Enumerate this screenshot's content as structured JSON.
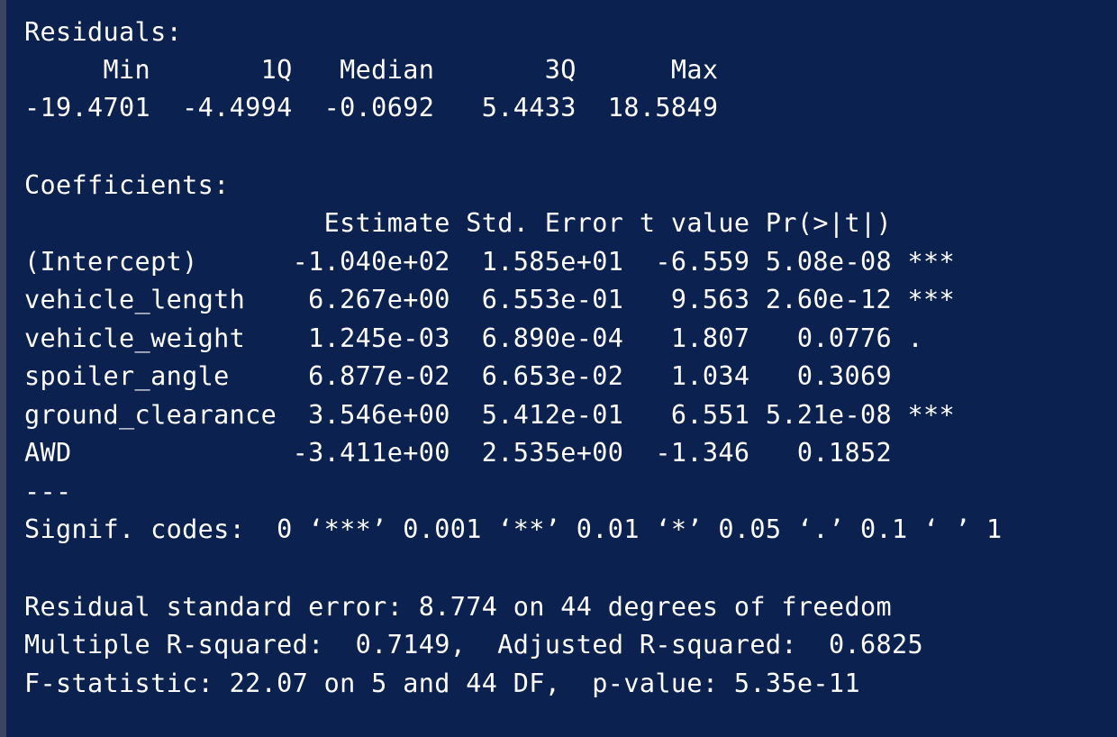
{
  "console": {
    "lines": [
      "Residuals:",
      "     Min       1Q   Median       3Q      Max",
      "-19.4701  -4.4994  -0.0692   5.4433  18.5849",
      "",
      "Coefficients:",
      "                   Estimate Std. Error t value Pr(>|t|)",
      "(Intercept)      -1.040e+02  1.585e+01  -6.559 5.08e-08 ***",
      "vehicle_length    6.267e+00  6.553e-01   9.563 2.60e-12 ***",
      "vehicle_weight    1.245e-03  6.890e-04   1.807   0.0776 .",
      "spoiler_angle     6.877e-02  6.653e-02   1.034   0.3069",
      "ground_clearance  3.546e+00  5.412e-01   6.551 5.21e-08 ***",
      "AWD              -3.411e+00  2.535e+00  -1.346   0.1852",
      "---",
      "Signif. codes:  0 ‘***’ 0.001 ‘**’ 0.01 ‘*’ 0.05 ‘.’ 0.1 ‘ ’ 1",
      "",
      "Residual standard error: 8.774 on 44 degrees of freedom",
      "Multiple R-squared:  0.7149,\tAdjusted R-squared:  0.6825",
      "F-statistic: 22.07 on 5 and 44 DF,  p-value: 5.35e-11"
    ]
  }
}
